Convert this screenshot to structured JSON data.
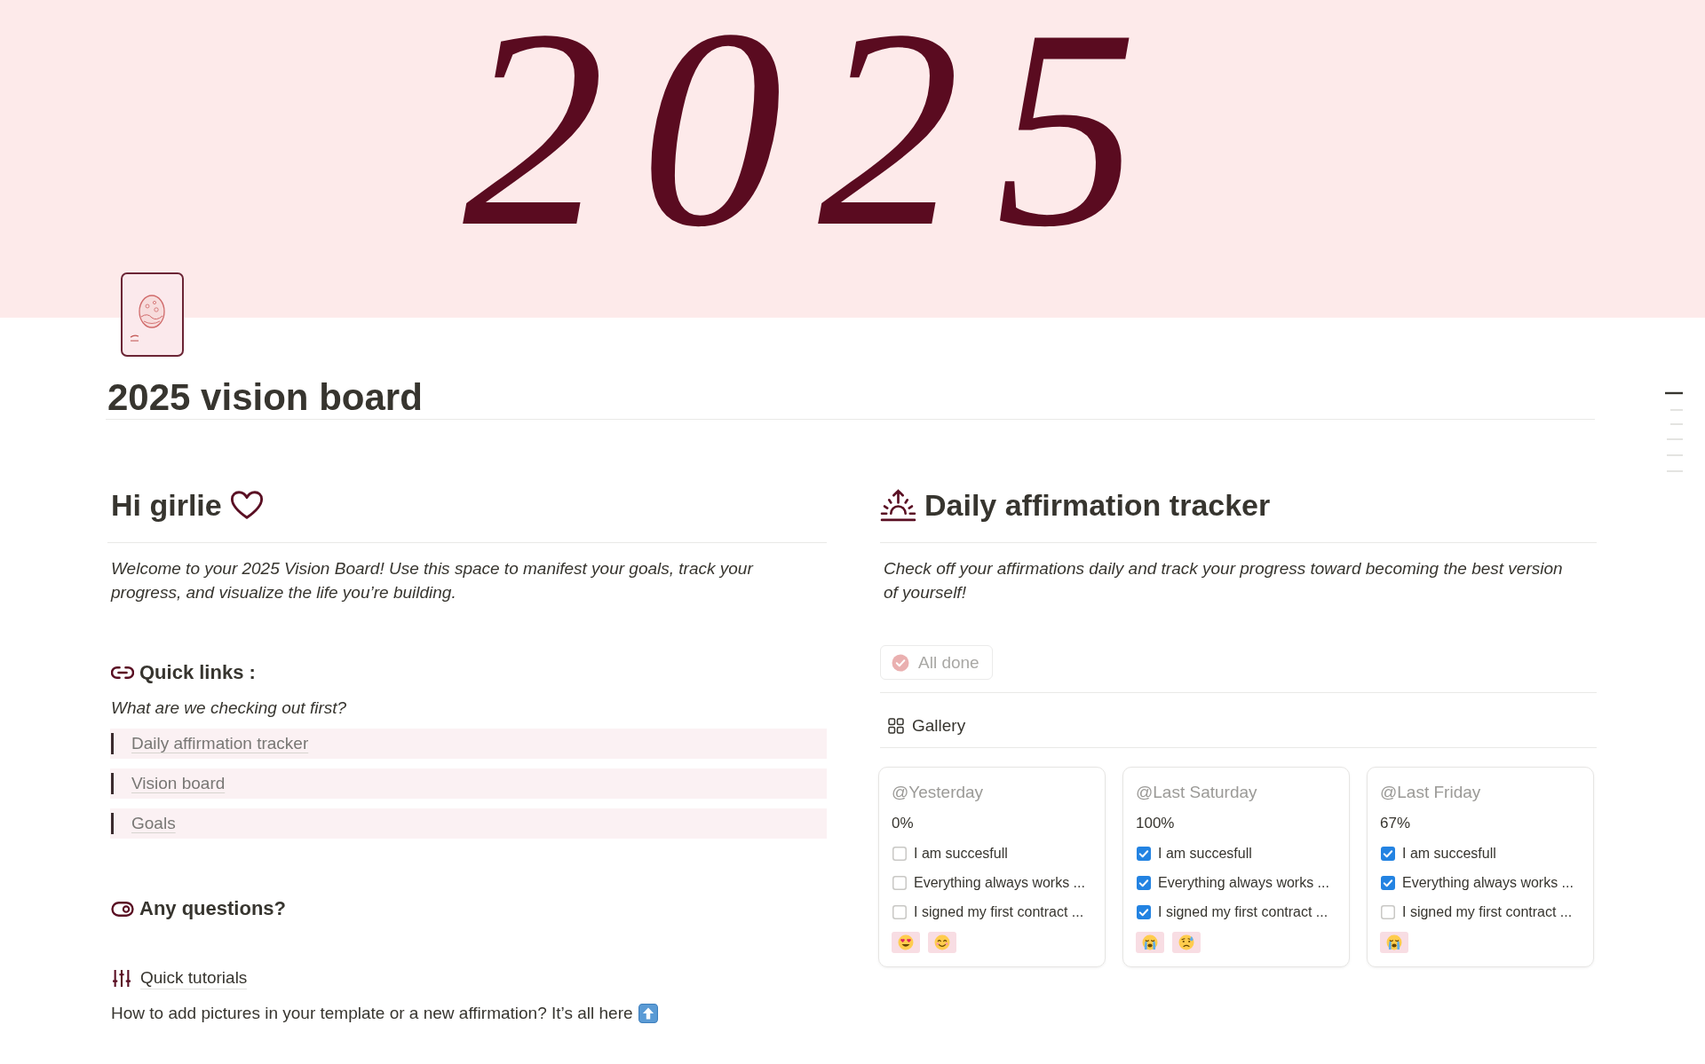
{
  "cover": {
    "text": "2025"
  },
  "page": {
    "title": "2025 vision board"
  },
  "left_column": {
    "heading": "Hi girlie",
    "intro": "Welcome to your 2025 Vision Board! Use this space to manifest your goals, track your progress, and visualize the life you’re building.",
    "quick_links": {
      "heading": "Quick links :",
      "prompt": "What are we checking out first?",
      "links": [
        "Daily affirmation tracker",
        "Vision board",
        "Goals"
      ]
    },
    "questions": {
      "heading": "Any questions?",
      "tutorial_link": "Quick tutorials",
      "help_text": "How to add pictures in your template or a new affirmation? It’s all here"
    }
  },
  "right_column": {
    "heading": "Daily affirmation tracker",
    "intro": "Check off your affirmations daily and track your progress toward becoming the best version of yourself!",
    "button": "All done",
    "view_tab": "Gallery",
    "cards": [
      {
        "date": "@Yesterday",
        "progress": "0%",
        "affirmations": [
          {
            "text": "I am succesfull",
            "checked": false
          },
          {
            "text": "Everything always works ...",
            "checked": false
          },
          {
            "text": "I signed my first contract ...",
            "checked": false
          }
        ],
        "moods": [
          {
            "kind": "heart-eyes"
          },
          {
            "kind": "smiling"
          }
        ]
      },
      {
        "date": "@Last Saturday",
        "progress": "100%",
        "affirmations": [
          {
            "text": "I am succesfull",
            "checked": true
          },
          {
            "text": "Everything always works ...",
            "checked": true
          },
          {
            "text": "I signed my first contract ...",
            "checked": true
          }
        ],
        "moods": [
          {
            "kind": "crying"
          },
          {
            "kind": "sad"
          }
        ]
      },
      {
        "date": "@Last Friday",
        "progress": "67%",
        "affirmations": [
          {
            "text": "I am succesfull",
            "checked": true
          },
          {
            "text": "Everything always works ...",
            "checked": true
          },
          {
            "text": "I signed my first contract ...",
            "checked": false
          }
        ],
        "moods": [
          {
            "kind": "crying"
          }
        ]
      }
    ]
  }
}
